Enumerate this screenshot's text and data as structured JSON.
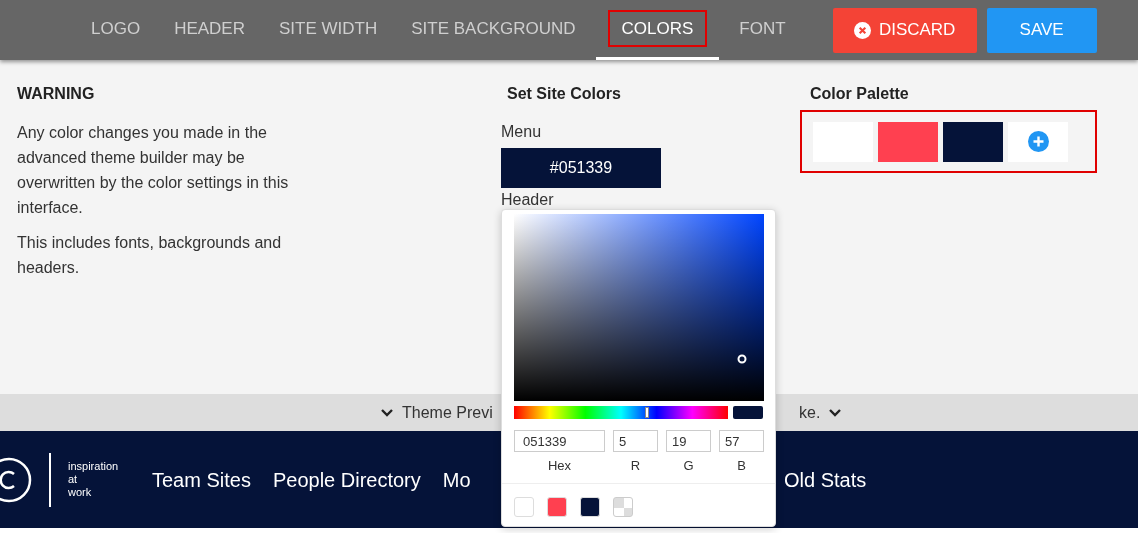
{
  "toolbar": {
    "tabs": [
      {
        "label": "LOGO",
        "selected": false
      },
      {
        "label": "HEADER",
        "selected": false
      },
      {
        "label": "SITE WIDTH",
        "selected": false
      },
      {
        "label": "SITE BACKGROUND",
        "selected": false
      },
      {
        "label": "COLORS",
        "selected": true
      },
      {
        "label": "FONT",
        "selected": false
      }
    ],
    "discard": "DISCARD",
    "save": "SAVE"
  },
  "warning": {
    "title": "WARNING",
    "paragraphs": [
      "Any color changes you made in the advanced theme builder may be overwritten by the color settings in this interface.",
      "This includes fonts, backgrounds and headers."
    ]
  },
  "site_colors": {
    "title": "Set Site Colors",
    "menu_label": "Menu",
    "menu_value": "#051339",
    "header_label": "Header"
  },
  "palette": {
    "title": "Color Palette",
    "swatches": [
      {
        "color": "#ffffff"
      },
      {
        "color": "#ff4050"
      },
      {
        "color": "#051339"
      }
    ]
  },
  "preview_bar": {
    "text_before": "Theme Previ",
    "text_after": "ke."
  },
  "site_nav": {
    "tagline": [
      "inspiration",
      "at",
      "work"
    ],
    "items_before": [
      "Team Sites",
      "People Directory",
      "Mo"
    ],
    "items_after": [
      "Old Stats"
    ]
  },
  "picker": {
    "hex": "051339",
    "r": "5",
    "g": "19",
    "b": "57",
    "hex_label": "Hex",
    "r_label": "R",
    "g_label": "G",
    "b_label": "B",
    "presets": [
      {
        "kind": "color",
        "color": "#ffffff"
      },
      {
        "kind": "color",
        "color": "#ff4050"
      },
      {
        "kind": "color",
        "color": "#051339"
      },
      {
        "kind": "transparent"
      }
    ]
  }
}
